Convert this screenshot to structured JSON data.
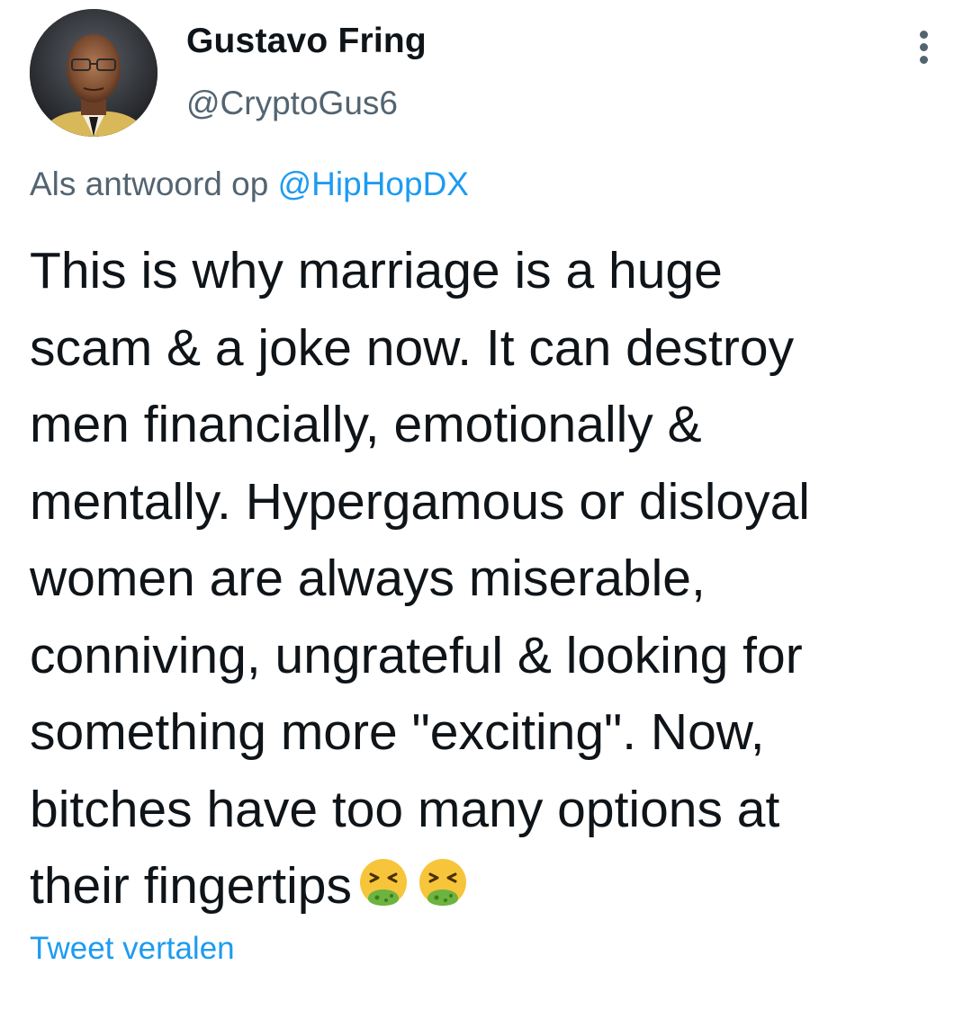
{
  "author": {
    "name": "Gustavo Fring",
    "handle": "@CryptoGus6",
    "avatar": "profile-photo"
  },
  "more_menu_icon": "more-vertical-icon",
  "reply_context": {
    "prefix": "Als antwoord op",
    "mention": "@HipHopDX"
  },
  "tweet": {
    "lines": [
      "This is why marriage is a huge",
      "scam & a joke now. It can destroy",
      "men financially, emotionally &",
      "mentally. Hypergamous or disloyal",
      "women are always miserable,",
      "conniving, ungrateful & looking for",
      "something more \"exciting\". Now,",
      "bitches have too many options at",
      "their fingertips"
    ],
    "trailing_emoji": [
      "face-vomiting-emoji",
      "face-vomiting-emoji"
    ]
  },
  "translate_label": "Tweet vertalen",
  "colors": {
    "text": "#0f1419",
    "secondary": "#536471",
    "link": "#1d9bf0",
    "background": "#ffffff"
  }
}
